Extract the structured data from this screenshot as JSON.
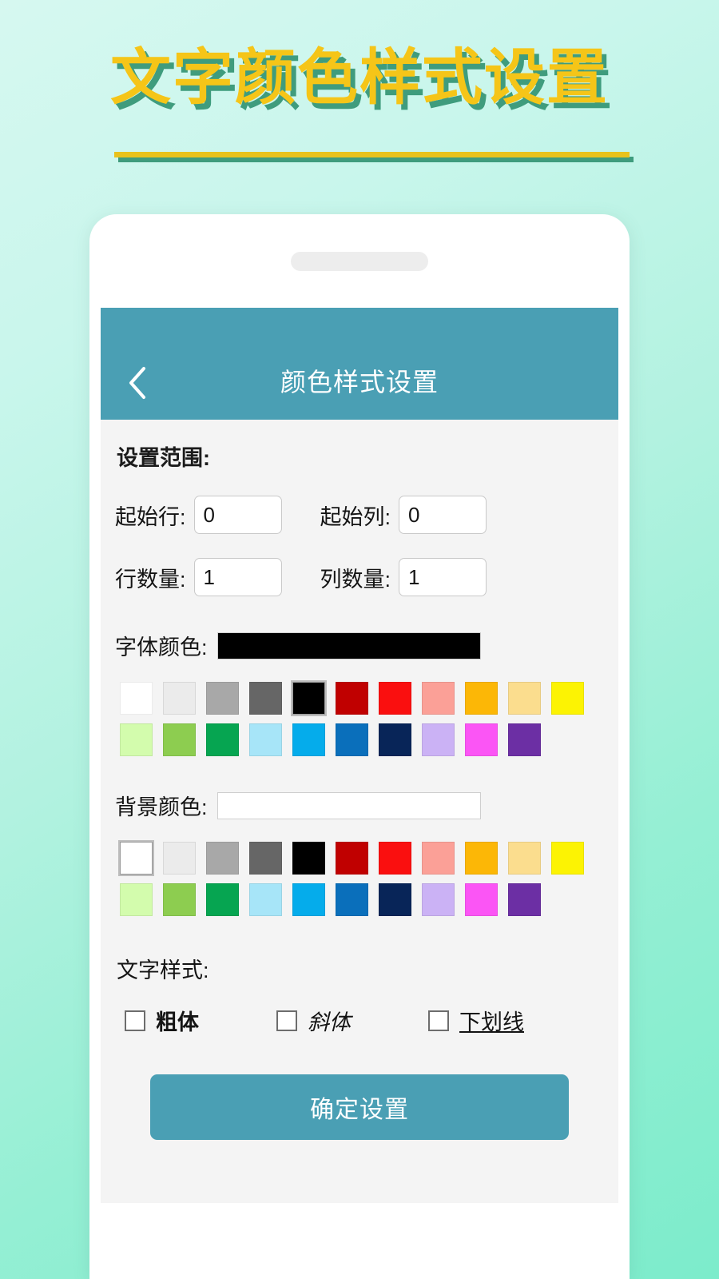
{
  "poster": {
    "title": "文字颜色样式设置",
    "title_color": "#f5c518",
    "title_shadow_color": "#3f9c7d",
    "background_gradient": [
      "#d6f8f0",
      "#7ceccb"
    ]
  },
  "appbar": {
    "title": "颜色样式设置",
    "back_icon": "chevron-left-icon",
    "background": "#4a9fb4",
    "text_color": "#ffffff"
  },
  "range_section": {
    "heading": "设置范围:",
    "fields": [
      {
        "label": "起始行:",
        "value": "0"
      },
      {
        "label": "起始列:",
        "value": "0"
      },
      {
        "label": "行数量:",
        "value": "1"
      },
      {
        "label": "列数量:",
        "value": "1"
      }
    ]
  },
  "font_color": {
    "label": "字体颜色:",
    "preview_value": "#000000",
    "selected_index": 4,
    "row1": [
      "#ffffff",
      "#ebebeb",
      "#a8a8a8",
      "#666666",
      "#000000",
      "#c00000",
      "#fa0f0f",
      "#fba097",
      "#fcb706",
      "#fbdd8e",
      "#fcf303"
    ],
    "row2": [
      "#d3fcad",
      "#8dcd50",
      "#06a551",
      "#a7e5f8",
      "#05aceb",
      "#0a6fbb",
      "#082558",
      "#cbb2f5",
      "#fb55f5",
      "#6c2fa4"
    ]
  },
  "background_color": {
    "label": "背景颜色:",
    "preview_value": "#ffffff",
    "selected_index": 0,
    "row1": [
      "#ffffff",
      "#ebebeb",
      "#a8a8a8",
      "#666666",
      "#000000",
      "#c00000",
      "#fa0f0f",
      "#fba097",
      "#fcb706",
      "#fbdd8e",
      "#fcf303"
    ],
    "row2": [
      "#d3fcad",
      "#8dcd50",
      "#06a551",
      "#a7e5f8",
      "#05aceb",
      "#0a6fbb",
      "#082558",
      "#cbb2f5",
      "#fb55f5",
      "#6c2fa4"
    ]
  },
  "text_style": {
    "heading": "文字样式:",
    "options": [
      {
        "label": "粗体",
        "checked": false,
        "style": "bold"
      },
      {
        "label": "斜体",
        "checked": false,
        "style": "italic"
      },
      {
        "label": "下划线",
        "checked": false,
        "style": "underline"
      }
    ]
  },
  "submit": {
    "label": "确定设置",
    "color": "#4a9fb4"
  }
}
